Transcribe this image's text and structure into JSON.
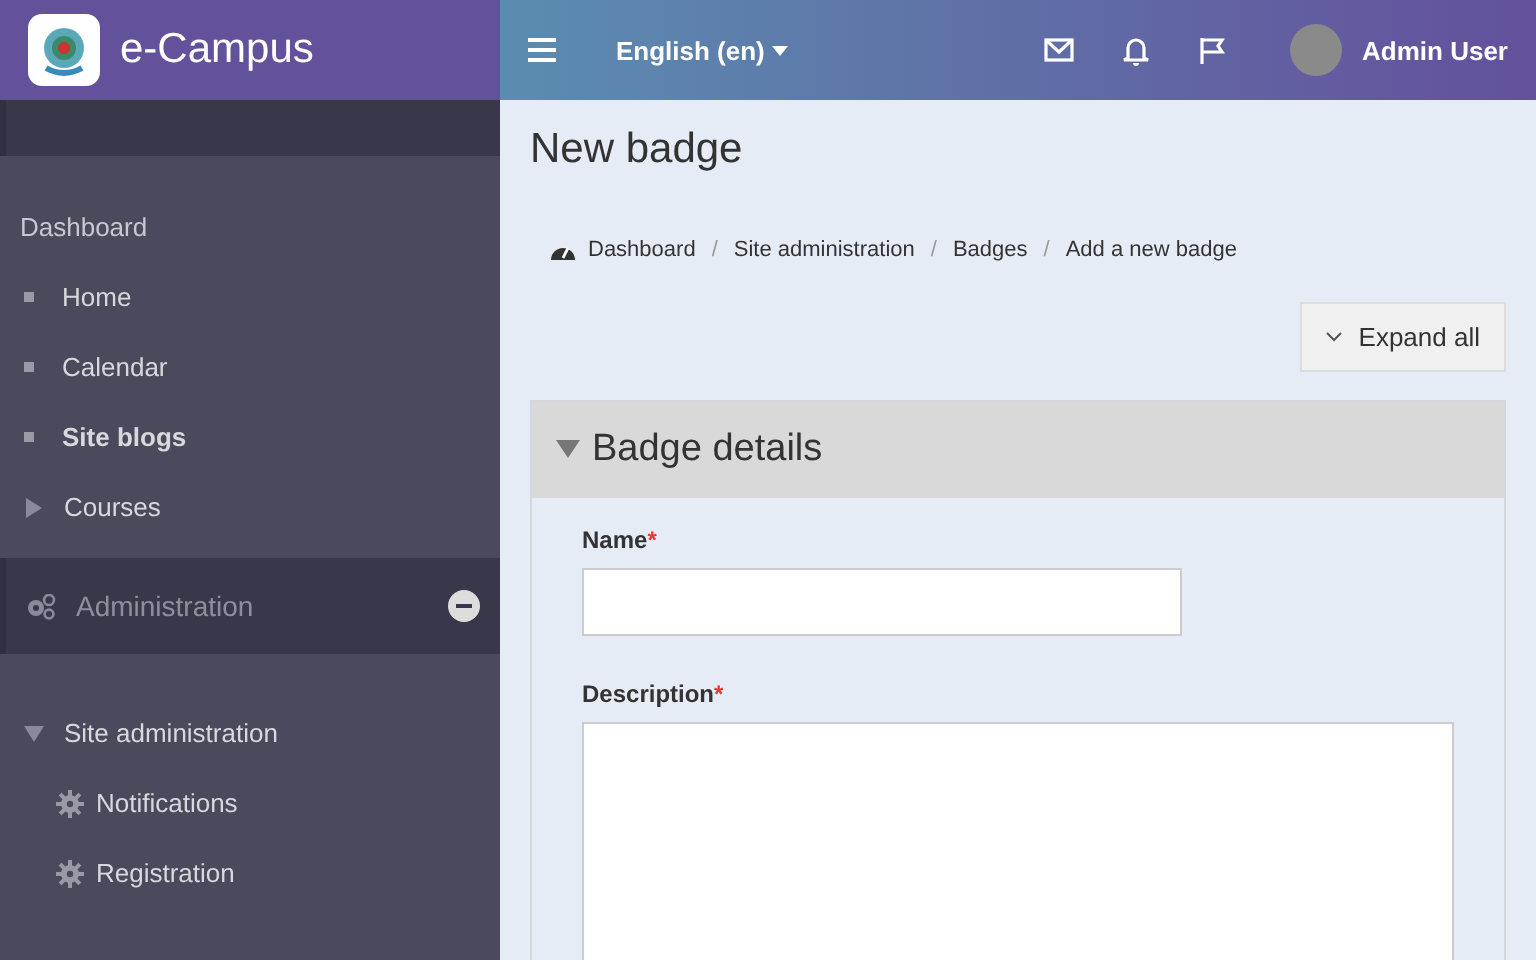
{
  "brand": {
    "name": "e-Campus"
  },
  "navbar": {
    "language": "English (en)",
    "user": "Admin User"
  },
  "sidebar": {
    "sections": [
      {
        "kind": "menu"
      },
      {
        "kind": "nav",
        "items": [
          {
            "kind": "heading",
            "label": "Dashboard",
            "active": false
          },
          {
            "kind": "leaf",
            "label": "Home",
            "active": false
          },
          {
            "kind": "leaf",
            "label": "Calendar",
            "active": false
          },
          {
            "kind": "leaf",
            "label": "Site blogs",
            "active": true
          },
          {
            "kind": "branch",
            "label": "Courses",
            "expanded": false,
            "active": false
          }
        ]
      },
      {
        "kind": "block",
        "title": "Administration",
        "expanded": true
      },
      {
        "kind": "nav",
        "items": [
          {
            "kind": "branch",
            "label": "Site administration",
            "expanded": true,
            "active": false
          },
          {
            "kind": "setting",
            "label": "Notifications",
            "active": false
          },
          {
            "kind": "setting",
            "label": "Registration",
            "active": false
          }
        ]
      }
    ]
  },
  "page": {
    "title": "New badge",
    "breadcrumb": [
      "Dashboard",
      "Site administration",
      "Badges",
      "Add a new badge"
    ],
    "breadcrumb_separator": "/",
    "expand_button": "Expand all",
    "fieldset": {
      "title": "Badge details",
      "expanded": true,
      "fields": [
        {
          "kind": "text",
          "label": "Name",
          "required_mark": "*"
        },
        {
          "kind": "textarea",
          "label": "Description",
          "required_mark": "*"
        }
      ]
    }
  }
}
